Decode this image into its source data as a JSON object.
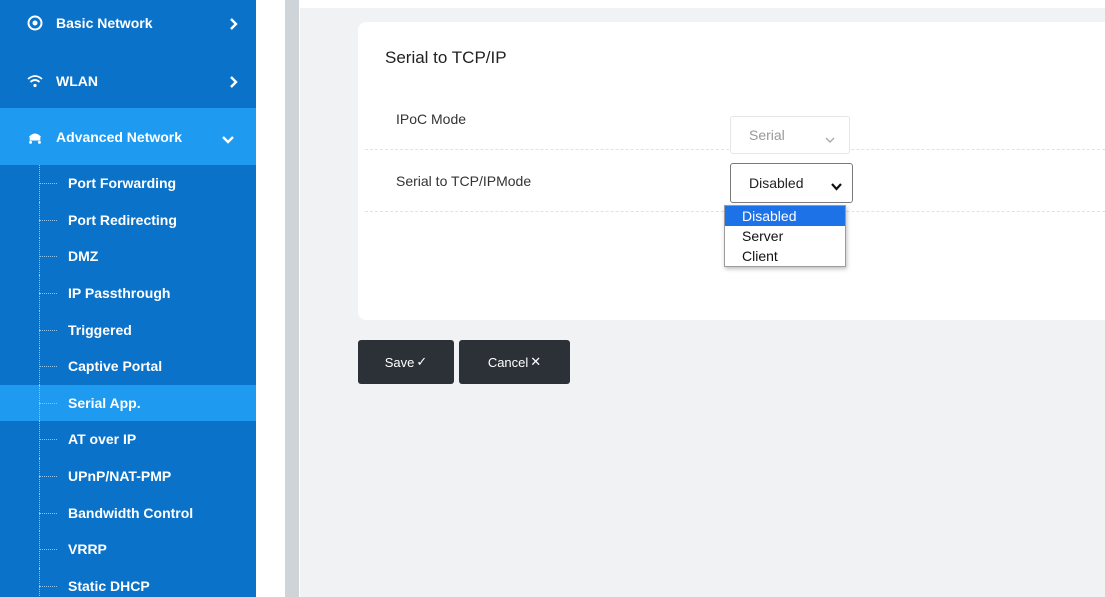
{
  "sidebar": {
    "top_items": [
      {
        "label": "Basic Network",
        "icon": "globe-icon"
      },
      {
        "label": "WLAN",
        "icon": "wifi-icon"
      },
      {
        "label": "Advanced Network",
        "icon": "network-hub-icon"
      }
    ],
    "sub_items": [
      {
        "label": "Port Forwarding"
      },
      {
        "label": "Port Redirecting"
      },
      {
        "label": "DMZ"
      },
      {
        "label": "IP Passthrough"
      },
      {
        "label": "Triggered"
      },
      {
        "label": "Captive Portal"
      },
      {
        "label": "Serial App."
      },
      {
        "label": "AT over IP"
      },
      {
        "label": "UPnP/NAT-PMP"
      },
      {
        "label": "Bandwidth Control"
      },
      {
        "label": "VRRP"
      },
      {
        "label": "Static DHCP"
      }
    ],
    "active_sub_item": "Serial App."
  },
  "card": {
    "title": "Serial to TCP/IP",
    "ipoc_mode": {
      "label": "IPoC Mode",
      "value": "Serial"
    },
    "tcp_mode": {
      "label": "Serial to TCP/IPMode",
      "value": "Disabled",
      "options": [
        "Disabled",
        "Server",
        "Client"
      ]
    }
  },
  "buttons": {
    "save_label": "Save",
    "save_glyph": "✓",
    "cancel_label": "Cancel",
    "cancel_glyph": "✕"
  },
  "colors": {
    "sidebar_bg": "#0b72c9",
    "sidebar_active": "#1e9bf0",
    "button_bg": "#2b3136",
    "option_highlight": "#1e72e8"
  }
}
